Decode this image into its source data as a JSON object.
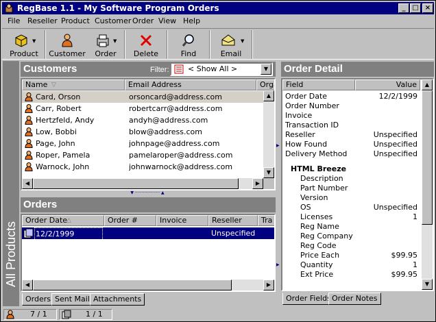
{
  "window": {
    "title": "RegBase 1.1 - My Software Program Orders",
    "controls": {
      "minimize": "_",
      "maximize": "□",
      "close": "×"
    }
  },
  "menu": [
    {
      "label": "File"
    },
    {
      "label": "Reseller"
    },
    {
      "label": "Product"
    },
    {
      "label": "Customer"
    },
    {
      "label": "Order"
    },
    {
      "label": "View"
    },
    {
      "label": "Help"
    }
  ],
  "toolbar": {
    "product": "Product",
    "customer": "Customer",
    "order": "Order",
    "delete": "Delete",
    "find": "Find",
    "email": "Email"
  },
  "sidebar": {
    "label": "All Products"
  },
  "customers": {
    "title": "Customers",
    "filter_label": "Filter:",
    "filter_value": "< Show All >",
    "columns": {
      "name": "Name",
      "email": "Email Address",
      "org": "Orga"
    },
    "rows": [
      {
        "name": "Card, Orson",
        "email": "orsoncard@address.com"
      },
      {
        "name": "Carr, Robert",
        "email": "robertcarr@address.com"
      },
      {
        "name": "Hertzfeld, Andy",
        "email": "andyh@address.com"
      },
      {
        "name": "Low, Bobbi",
        "email": "blow@address.com"
      },
      {
        "name": "Page, John",
        "email": "johnpage@address.com"
      },
      {
        "name": "Roper, Pamela",
        "email": "pamelaroper@address.com"
      },
      {
        "name": "Warnock, John",
        "email": "johnwarnock@address.com"
      }
    ],
    "selected_index": 0
  },
  "orders": {
    "title": "Orders",
    "columns": {
      "date": "Order Date",
      "num": "Order #",
      "invoice": "Invoice",
      "reseller": "Reseller",
      "tra": "Tra"
    },
    "rows": [
      {
        "date": "12/2/1999",
        "num": "",
        "invoice": "",
        "reseller": "Unspecified"
      }
    ],
    "tabs": {
      "orders": "Orders",
      "sent_mail": "Sent Mail",
      "attachments": "Attachments"
    }
  },
  "order_detail": {
    "title": "Order Detail",
    "columns": {
      "field": "Field",
      "value": "Value"
    },
    "fields": [
      {
        "field": "Order Date",
        "value": "12/2/1999"
      },
      {
        "field": "Order Number",
        "value": ""
      },
      {
        "field": "Invoice",
        "value": ""
      },
      {
        "field": "Transaction ID",
        "value": ""
      },
      {
        "field": "Reseller",
        "value": "Unspecified"
      },
      {
        "field": "How Found",
        "value": "Unspecified"
      },
      {
        "field": "Delivery Method",
        "value": "Unspecified"
      }
    ],
    "product_name": "HTML Breeze",
    "product_fields": [
      {
        "field": "Description",
        "value": ""
      },
      {
        "field": "Part Number",
        "value": ""
      },
      {
        "field": "Version",
        "value": ""
      },
      {
        "field": "OS",
        "value": "Unspecified"
      },
      {
        "field": "Licenses",
        "value": "1"
      },
      {
        "field": "Reg Name",
        "value": ""
      },
      {
        "field": "Reg Company",
        "value": ""
      },
      {
        "field": "Reg Code",
        "value": ""
      },
      {
        "field": "Price Each",
        "value": "$99.95"
      },
      {
        "field": "Quantity",
        "value": "1"
      },
      {
        "field": "Ext Price",
        "value": "$99.95"
      }
    ],
    "tabs": {
      "order_fields": "Order Fields",
      "order_notes": "Order Notes"
    }
  },
  "status": {
    "customers_count": "7 / 1",
    "orders_count": "1 / 1"
  },
  "colors": {
    "titlebar": "#000080",
    "selection": "#000080",
    "panel_header": "#808080",
    "face": "#c0c0c0"
  }
}
